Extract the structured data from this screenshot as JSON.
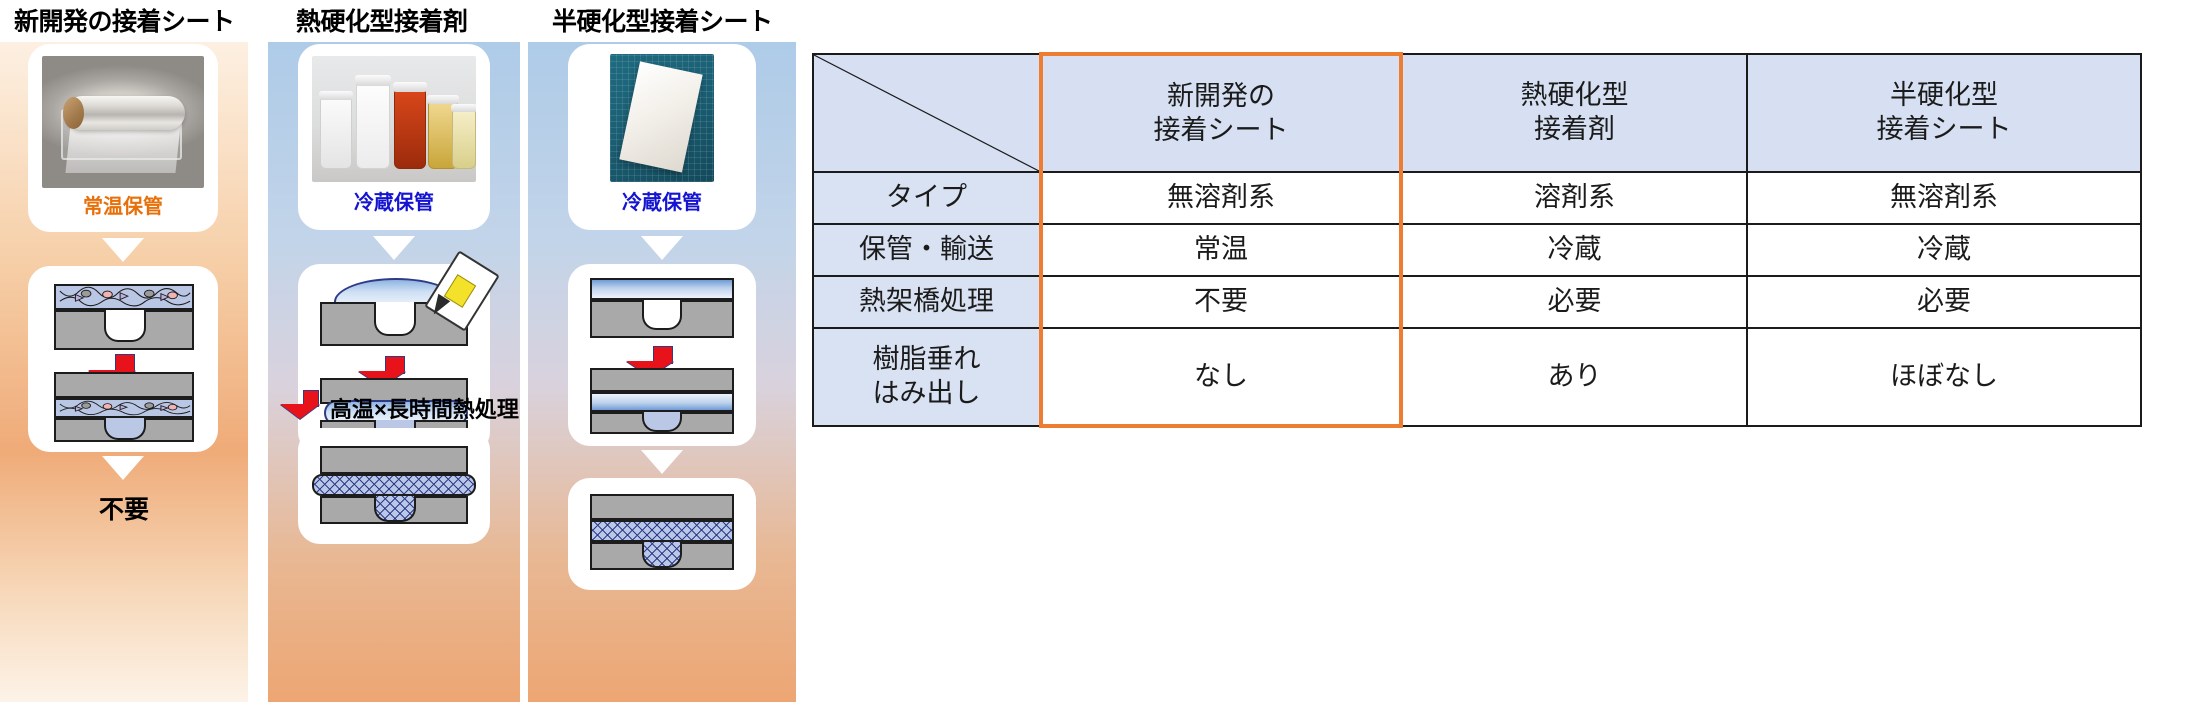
{
  "panels": [
    {
      "title": "新開発の接着シート",
      "photo_caption": "常温保管",
      "photo_caption_color": "#e8700a",
      "bottom_label": "不要",
      "photo_name": "adhesive-sheet-roll-photo"
    },
    {
      "title": "熱硬化型接着剤",
      "photo_caption": "冷蔵保管",
      "photo_caption_color": "#1414d2",
      "heat_label": "高温×長時間熱処理",
      "photo_name": "thermoset-adhesive-bottles-photo"
    },
    {
      "title": "半硬化型接着シート",
      "photo_caption": "冷蔵保管",
      "photo_caption_color": "#1414d2",
      "photo_name": "semi-cured-adhesive-sheet-photo"
    }
  ],
  "table": {
    "corner_label": "",
    "columns": [
      {
        "line1": "新開発の",
        "line2": "接着シート",
        "highlight": true
      },
      {
        "line1": "熱硬化型",
        "line2": "接着剤",
        "highlight": false
      },
      {
        "line1": "半硬化型",
        "line2": "接着シート",
        "highlight": false
      }
    ],
    "rows": [
      {
        "header_line1": "タイプ",
        "header_line2": "",
        "values": [
          "無溶剤系",
          "溶剤系",
          "無溶剤系"
        ]
      },
      {
        "header_line1": "保管・輸送",
        "header_line2": "",
        "values": [
          "常温",
          "冷蔵",
          "冷蔵"
        ]
      },
      {
        "header_line1": "熱架橋処理",
        "header_line2": "",
        "values": [
          "不要",
          "必要",
          "必要"
        ]
      },
      {
        "header_line1": "樹脂垂れ",
        "header_line2": "はみ出し",
        "values": [
          "なし",
          "あり",
          "ほぼなし"
        ]
      }
    ],
    "highlight_color": "#ed7d31",
    "header_bg": "#d6e0f2"
  }
}
